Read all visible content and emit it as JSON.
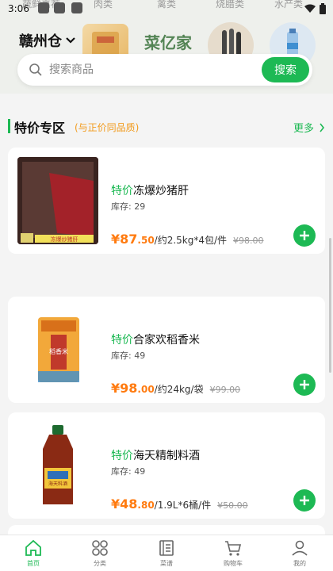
{
  "status_bar": {
    "time": "3:06"
  },
  "category_strip": [
    "蔬鲜嘉荐",
    "肉类",
    "禽类",
    "烧腊类",
    "水产类"
  ],
  "header": {
    "warehouse": "赣州仓",
    "brand_text": "菜亿家",
    "search": {
      "placeholder": "搜索商品",
      "button": "搜索"
    }
  },
  "section": {
    "title": "特价专区",
    "subtitle": "(与正价同品质)",
    "more": "更多"
  },
  "products": [
    {
      "tag": "特价",
      "name": "冻爆炒猪肝",
      "stock": "库存: 29",
      "currency": "¥",
      "price_int": "87",
      "price_dec": ".50",
      "unit": "/约2.5kg*4包/件",
      "old_price": "¥98.00",
      "img_label": "冻爆炒猪肝"
    },
    {
      "tag": "特价",
      "name": "合家欢稻香米",
      "stock": "库存: 49",
      "currency": "¥",
      "price_int": "98",
      "price_dec": ".00",
      "unit": "/约24kg/袋",
      "old_price": "¥99.00",
      "img_label": "稻香米"
    },
    {
      "tag": "特价",
      "name": "海天精制料酒",
      "stock": "库存: 49",
      "currency": "¥",
      "price_int": "48",
      "price_dec": ".80",
      "unit": "/1.9L*6桶/件",
      "old_price": "¥50.00",
      "img_label": "海天料酒"
    }
  ],
  "bottom_nav": [
    {
      "label": "首页",
      "icon": "home-icon",
      "active": true
    },
    {
      "label": "分类",
      "icon": "category-icon",
      "active": false
    },
    {
      "label": "菜谱",
      "icon": "recipe-book-icon",
      "active": false
    },
    {
      "label": "购物车",
      "icon": "cart-icon",
      "active": false
    },
    {
      "label": "我的",
      "icon": "profile-icon",
      "active": false
    }
  ],
  "colors": {
    "accent": "#1db954",
    "price": "#ff7b10",
    "subtitle": "#f29b1d"
  }
}
